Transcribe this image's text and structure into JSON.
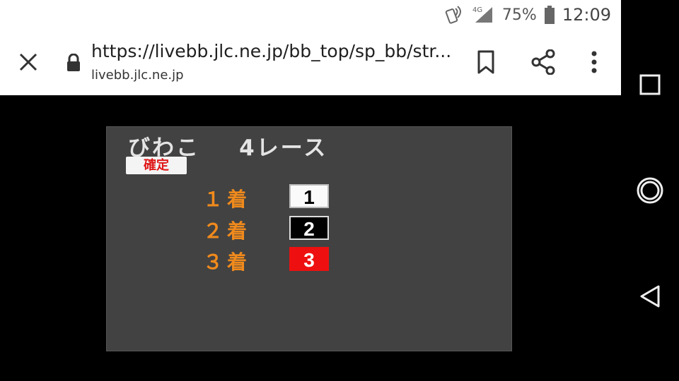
{
  "statusbar": {
    "battery": "75%",
    "time": "12:09",
    "network": "4G"
  },
  "browser": {
    "url": "https://livebb.jlc.ne.jp/bb_top/sp_bb/str...",
    "domain": "livebb.jlc.ne.jp"
  },
  "race": {
    "venue": "びわこ",
    "race": "4レース",
    "status": "確定",
    "results": [
      {
        "place": "１着",
        "boat": "1",
        "color": "#fafafa"
      },
      {
        "place": "２着",
        "boat": "2",
        "color": "#000000"
      },
      {
        "place": "３着",
        "boat": "3",
        "color": "#ee1010"
      }
    ]
  },
  "icons": {
    "close": "close-icon",
    "lock": "lock-icon",
    "bookmark": "bookmark-icon",
    "share": "share-icon",
    "menu": "more-vert-icon",
    "recents": "square-icon",
    "home": "circle-icon",
    "back": "triangle-back-icon"
  }
}
